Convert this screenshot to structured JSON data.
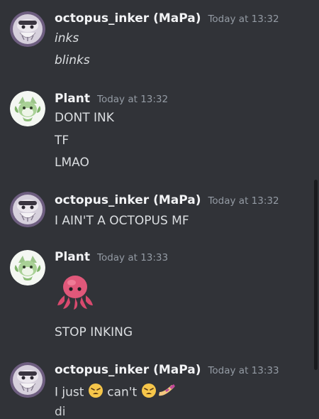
{
  "messages": [
    {
      "author": "octopus_inker (MaPa)",
      "time": "Today at 13:32",
      "lines": [
        "inks",
        "blinks"
      ]
    },
    {
      "author": "Plant",
      "time": "Today at 13:32",
      "lines": [
        "DONT INK",
        "TF",
        "LMAO"
      ]
    },
    {
      "author": "octopus_inker (MaPa)",
      "time": "Today at 13:32",
      "lines": [
        "I AIN'T A OCTOPUS MF"
      ]
    },
    {
      "author": "Plant",
      "time": "Today at 13:33",
      "emoji": "octopus-emoji",
      "lines": [
        "STOP INKING"
      ]
    },
    {
      "author": "octopus_inker (MaPa)",
      "time": "Today at 13:33",
      "line_parts": [
        "I just",
        "can't"
      ],
      "emojis": [
        "weary-face-emoji",
        "weary-face-emoji",
        "nail-polish-emoji"
      ],
      "cut_line": "di"
    }
  ],
  "colors": {
    "background": "#313338",
    "username": "#f2f3f5",
    "timestamp": "#949ba4",
    "text": "#dbdee1"
  }
}
